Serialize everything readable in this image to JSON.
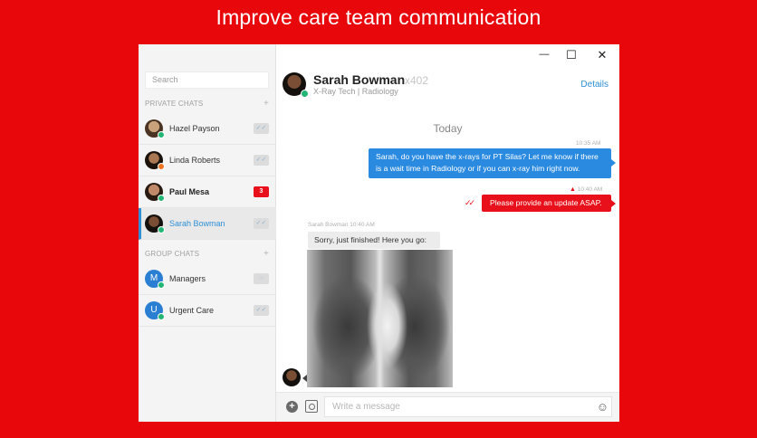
{
  "banner": {
    "title": "Improve care team communication"
  },
  "window": {
    "minimize_glyph": "—",
    "maximize_glyph": "☐",
    "close_glyph": "✕"
  },
  "sidebar": {
    "search_placeholder": "Search",
    "private_header": "PRIVATE CHATS",
    "group_header": "GROUP CHATS",
    "add_glyph": "+",
    "private_chats": [
      {
        "name": "Hazel Payson",
        "status": "green",
        "indicator": "✓✓"
      },
      {
        "name": "Linda Roberts",
        "status": "orange",
        "indicator": "✓✓"
      },
      {
        "name": "Paul Mesa",
        "status": "green",
        "unread": "3"
      },
      {
        "name": "Sarah Bowman",
        "status": "green",
        "indicator": "✓✓",
        "selected": true
      }
    ],
    "group_chats": [
      {
        "name": "Managers",
        "initial": "M",
        "indicator": "◌·"
      },
      {
        "name": "Urgent Care",
        "initial": "U",
        "indicator": "✓✓"
      }
    ]
  },
  "conversation": {
    "contact_name": "Sarah Bowman",
    "extension": "x402",
    "role": "X-Ray Tech | Radiology",
    "details_label": "Details",
    "day_label": "Today",
    "messages": [
      {
        "time": "10:35 AM",
        "text": "Sarah, do you have the x-rays for PT Silas? Let me know if there is a wait time in Radiology or if you can x-ray him right now."
      },
      {
        "time": "10:40 AM",
        "text": "Please provide an update ASAP.",
        "priority": true
      },
      {
        "sender": "Sarah Bowman",
        "time": "10:40 AM",
        "text": "Sorry, just finished! Here you go:"
      }
    ],
    "input_placeholder": "Write a message"
  },
  "colors": {
    "brand_red": "#e8080c",
    "accent_blue": "#2a8ae0",
    "online_green": "#22b573",
    "away_orange": "#f0731f"
  }
}
